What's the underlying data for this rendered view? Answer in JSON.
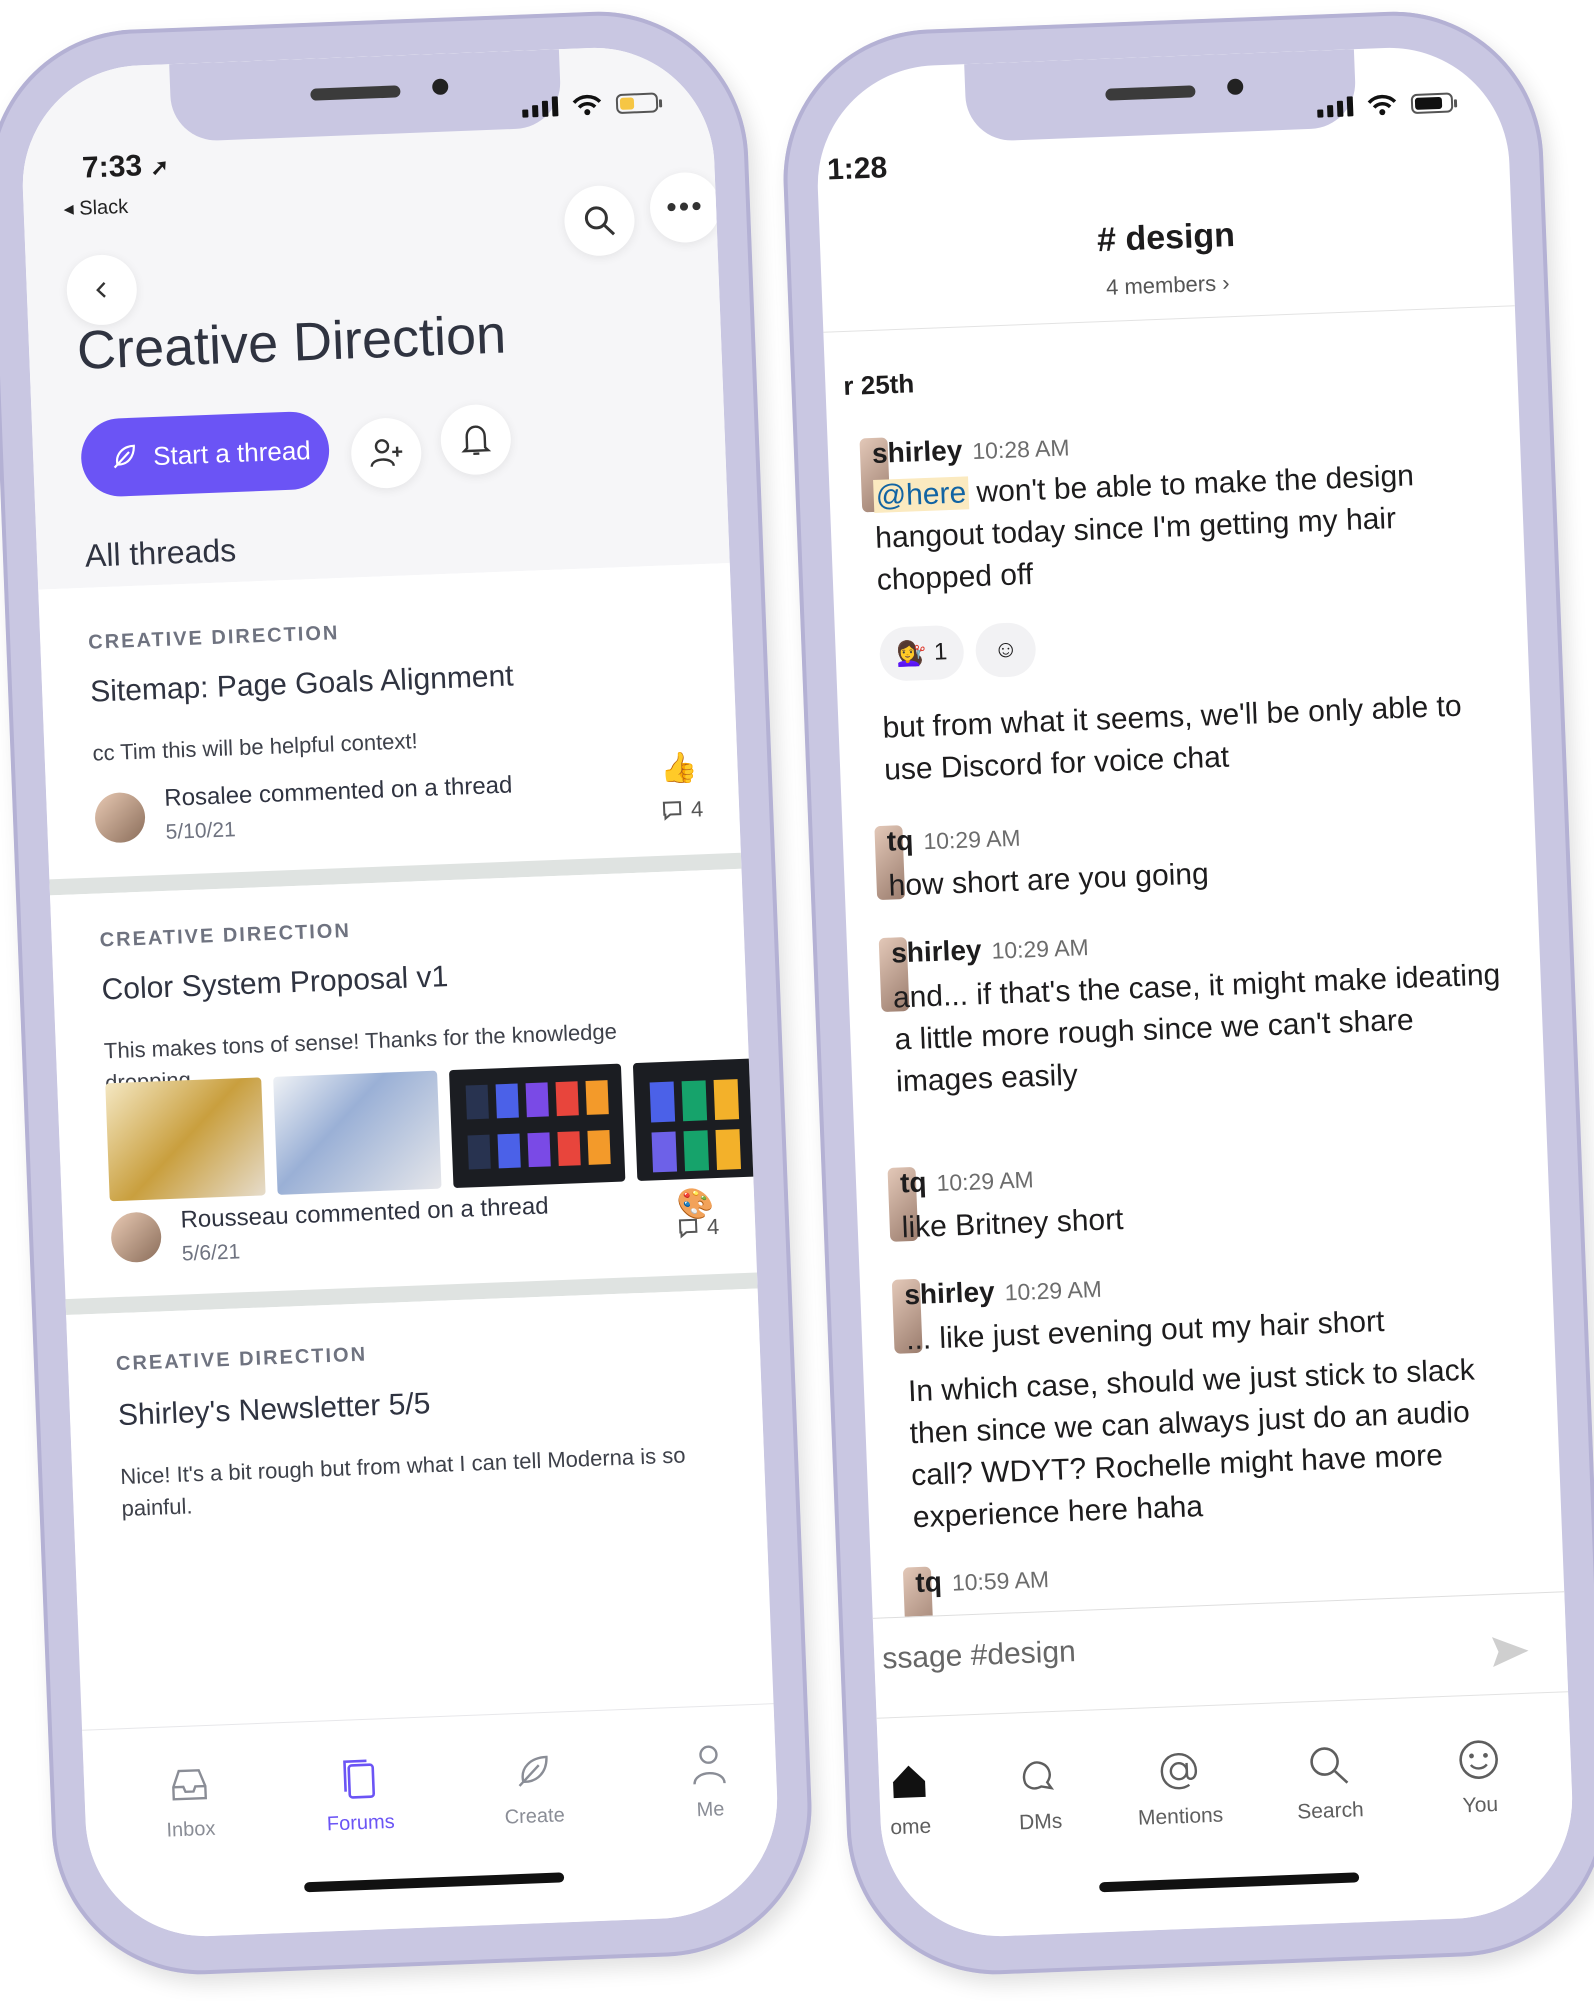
{
  "left": {
    "status": {
      "time": "7:33",
      "back_app": "Slack",
      "battery_color": "#f6c644"
    },
    "header": {
      "title": "Creative Direction",
      "start_thread": "Start a thread",
      "section": "All threads"
    },
    "threads": [
      {
        "category": "CREATIVE DIRECTION",
        "title": "Sitemap: Page Goals Alignment",
        "snippet": "cc Tim this will be helpful context!",
        "commenter": "Rosalee commented on a thread",
        "date": "5/10/21",
        "reaction_icon": "thumbs-up-icon",
        "replies": "4"
      },
      {
        "category": "CREATIVE DIRECTION",
        "title": "Color System Proposal v1",
        "snippet": "This makes tons of sense! Thanks for the knowledge dropping.",
        "commenter": "Rousseau commented on a thread",
        "date": "5/6/21",
        "reaction_icon": "palette-icon",
        "replies": "4"
      },
      {
        "category": "CREATIVE DIRECTION",
        "title": "Shirley's Newsletter 5/5",
        "snippet": "Nice! It's a bit rough but from what I can tell Moderna is so painful."
      }
    ],
    "tabs": [
      "Inbox",
      "Forums",
      "Create",
      "Me"
    ],
    "accent": "#6b54f5"
  },
  "right": {
    "status": {
      "time": "1:28",
      "battery_color": "#111111"
    },
    "channel": {
      "name": "# design",
      "members": "4 members ›"
    },
    "date_divider": "r 25th",
    "messages": [
      {
        "user": "shirley",
        "time": "10:28 AM",
        "mention": "@here",
        "text": " won't be able to make the design hangout today since I'm getting my hair chopped off"
      },
      {
        "reaction_count": "1",
        "text2": "but from what it seems, we'll be only able to use Discord for voice chat"
      },
      {
        "user": "tq",
        "time": "10:29 AM",
        "text": "how short are you going"
      },
      {
        "user": "shirley",
        "time": "10:29 AM",
        "text": "and... if that's the case, it might make ideating a little more rough since we can't share images easily"
      },
      {
        "user": "tq",
        "time": "10:29 AM",
        "text": "like Britney short"
      },
      {
        "user": "shirley",
        "time": "10:29 AM",
        "text": "... like just evening out my hair short",
        "text2": "In which case, should we just stick to slack then since we can always just do an audio call? WDYT? Rochelle might have more experience here haha"
      },
      {
        "user": "tq",
        "time": "10:59 AM"
      }
    ],
    "composer_placeholder": "ssage #design",
    "tabs": [
      "ome",
      "DMs",
      "Mentions",
      "Search",
      "You"
    ]
  }
}
